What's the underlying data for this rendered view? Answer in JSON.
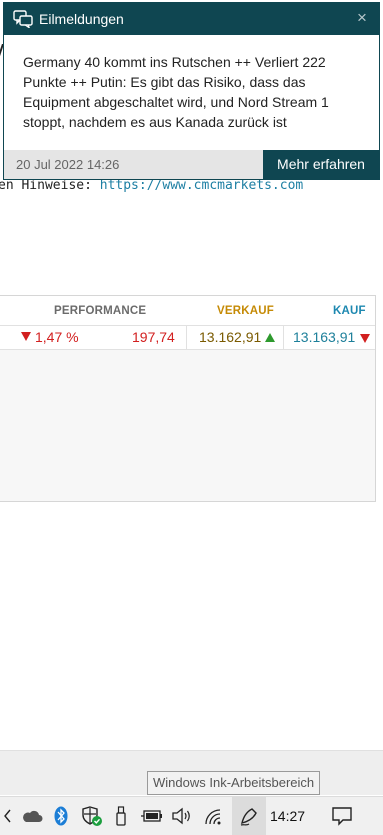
{
  "page": {
    "disclaimer_prefix": "en Hinweise: ",
    "disclaimer_link": "https://www.cmcmarkets.com"
  },
  "quote_table": {
    "headers": {
      "performance": "PERFORMANCE",
      "sell": "VERKAUF",
      "buy": "KAUF"
    },
    "row": {
      "change_percent": "1,47 %",
      "change_points": "197,74",
      "sell": "13.162,91",
      "buy": "13.163,91",
      "change_direction": "down",
      "sell_direction": "up",
      "buy_direction": "down"
    }
  },
  "notification": {
    "title": "Eilmeldungen",
    "close_label": "×",
    "message": "Germany 40 kommt ins Rutschen ++ Verliert 222 Punkte ++ Putin: Es gibt das Risiko, dass das Equipment abgeschaltet wird, und Nord Stream 1 stoppt, nachdem es aus Kanada zurück ist",
    "date": "20 Jul 2022 14:26",
    "action_label": "Mehr erfahren",
    "accent_color": "#0f4651"
  },
  "taskbar": {
    "tooltip": "Windows Ink-Arbeitsbereich",
    "clock": "14:27",
    "tray_icons": [
      "chevron-left-icon",
      "onedrive-icon",
      "bluetooth-icon",
      "windows-security-icon",
      "usb-eject-icon",
      "battery-icon",
      "speaker-icon",
      "wifi-icon",
      "windows-ink-icon",
      "notification-center-icon"
    ]
  },
  "colors": {
    "negative": "#d21f1f",
    "positive": "#2e9a2e",
    "sell_header": "#c58a05",
    "buy_header": "#1d88b0"
  }
}
